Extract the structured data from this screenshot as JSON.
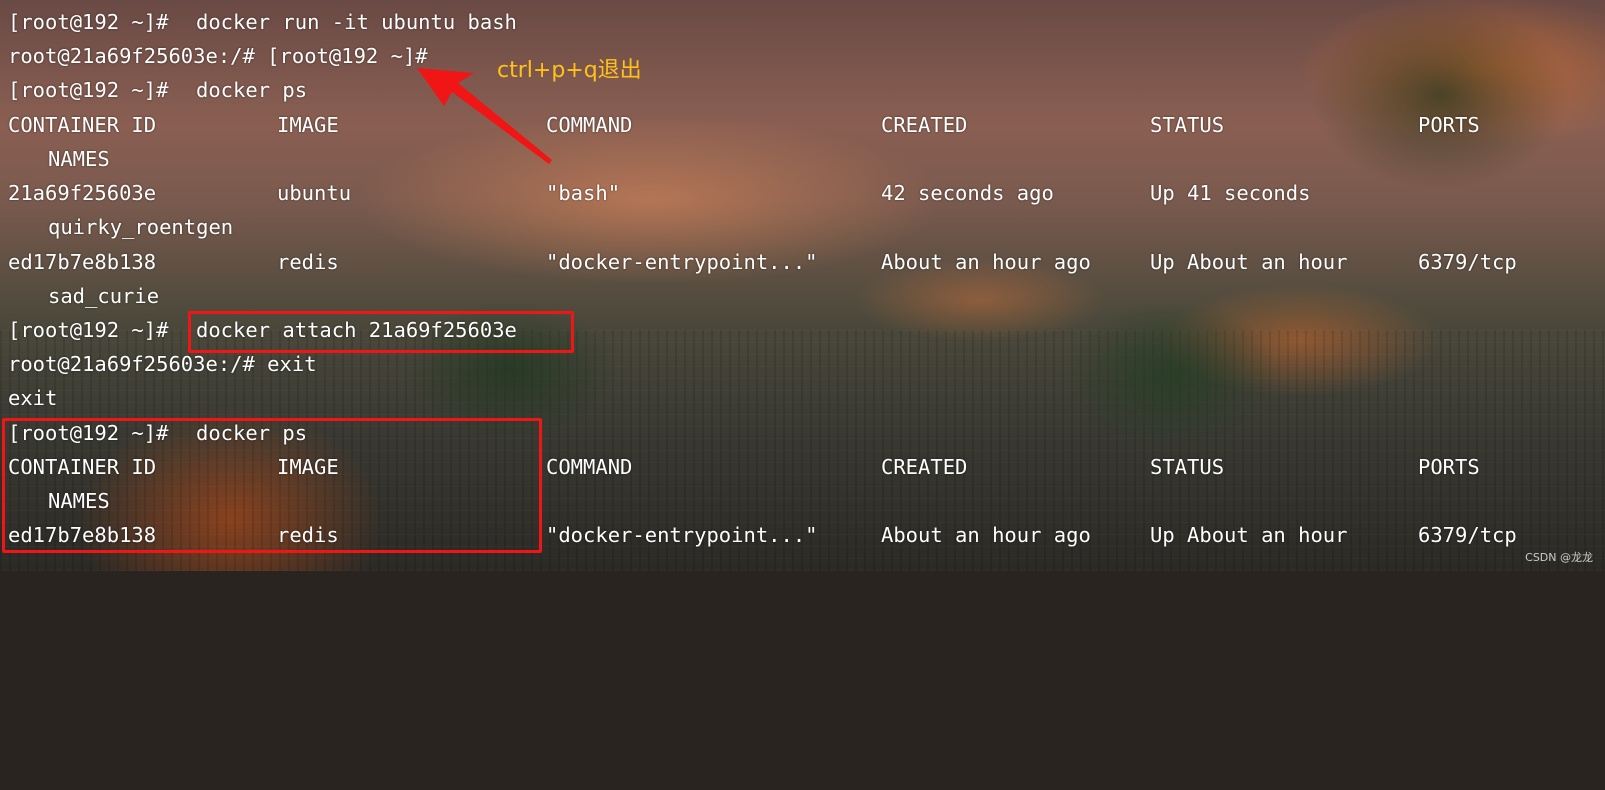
{
  "terminal": {
    "lines": [
      {
        "prompt": "[root@192 ~]#",
        "command": "docker run -it ubuntu bash"
      },
      {
        "text": "root@21a69f25603e:/# [root@192 ~]#"
      },
      {
        "prompt": "[root@192 ~]#",
        "command": "docker ps"
      },
      {
        "header": [
          "CONTAINER ID",
          "IMAGE",
          "COMMAND",
          "CREATED",
          "STATUS",
          "PORTS"
        ],
        "names_header": "NAMES"
      },
      {
        "row": [
          "21a69f25603e",
          "ubuntu",
          "\"bash\"",
          "42 seconds ago",
          "Up 41 seconds",
          ""
        ],
        "name": "quirky_roentgen"
      },
      {
        "row": [
          "ed17b7e8b138",
          "redis",
          "\"docker-entrypoint...\"",
          "About an hour ago",
          "Up About an hour",
          "6379/tcp"
        ],
        "name": "sad_curie"
      },
      {
        "prompt": "[root@192 ~]#",
        "command": "docker attach 21a69f25603e"
      },
      {
        "text": "root@21a69f25603e:/# exit"
      },
      {
        "text": "exit"
      },
      {
        "prompt": "[root@192 ~]#",
        "command": "docker ps"
      },
      {
        "header": [
          "CONTAINER ID",
          "IMAGE",
          "COMMAND",
          "CREATED",
          "STATUS",
          "PORTS"
        ],
        "names_header": "NAMES"
      },
      {
        "row": [
          "ed17b7e8b138",
          "redis",
          "\"docker-entrypoint...\"",
          "About an hour ago",
          "Up About an hour",
          "6379/tcp"
        ]
      }
    ]
  },
  "annotation": {
    "label": "ctrl+p+q退出",
    "label_color": "#ffc21a",
    "box_color": "#f01616"
  },
  "watermark": "CSDN @龙龙"
}
